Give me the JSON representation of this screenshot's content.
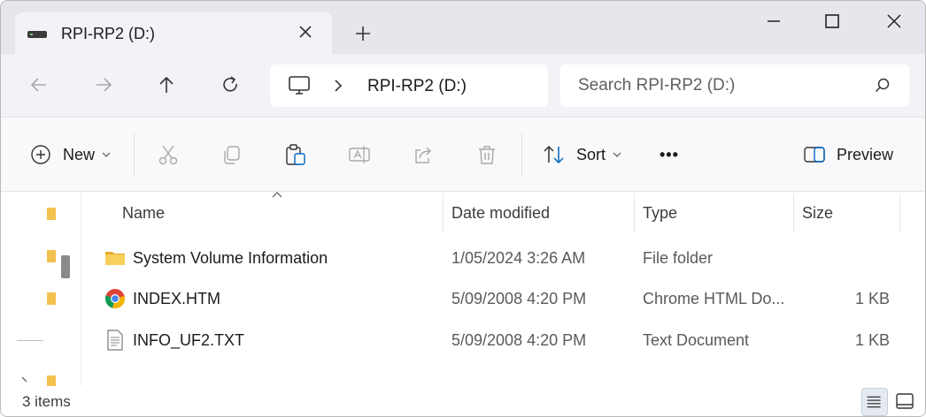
{
  "window": {
    "tab_title": "RPI-RP2 (D:)",
    "controls": [
      "minimize",
      "maximize",
      "close"
    ]
  },
  "navigation": {
    "address": "RPI-RP2 (D:)",
    "search_placeholder": "Search RPI-RP2 (D:)"
  },
  "toolbar": {
    "new_label": "New",
    "sort_label": "Sort",
    "more_label": "•••",
    "preview_label": "Preview"
  },
  "columns": {
    "name": "Name",
    "date": "Date modified",
    "type": "Type",
    "size": "Size"
  },
  "files": [
    {
      "icon": "folder-icon",
      "name": "System Volume Information",
      "date": "1/05/2024 3:26 AM",
      "type": "File folder",
      "size": ""
    },
    {
      "icon": "chrome-icon",
      "name": "INDEX.HTM",
      "date": "5/09/2008 4:20 PM",
      "type": "Chrome HTML Do...",
      "size": "1 KB"
    },
    {
      "icon": "text-document-icon",
      "name": "INFO_UF2.TXT",
      "date": "5/09/2008 4:20 PM",
      "type": "Text Document",
      "size": "1 KB"
    }
  ],
  "status": {
    "item_count": "3 items"
  },
  "colors": {
    "titlebar": "#e8e6ec",
    "navbar": "#f4f2f6",
    "folder": "#f2c14e",
    "accent": "#0067c0"
  }
}
